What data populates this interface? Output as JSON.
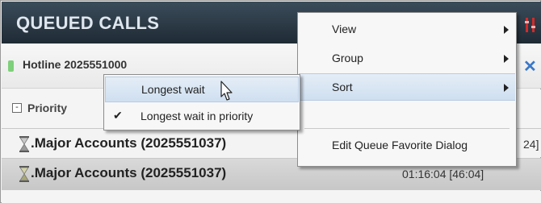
{
  "panel": {
    "title": "QUEUED CALLS",
    "hotline": "Hotline 2025551000",
    "priority_label": "Priority",
    "collapse_symbol": "-",
    "colors": {
      "titlebar": "#2b3a46",
      "status_dot": "#7ed07a",
      "close": "#3a78c8",
      "settings_accent": "#d02b2b"
    }
  },
  "calls": [
    {
      "name": ".Major Accounts (2025551037)",
      "time_tail": "24]"
    },
    {
      "name": ".Major Accounts (2025551037)",
      "time": "01:16:04 [46:04]"
    }
  ],
  "menu": {
    "items": [
      {
        "label": "View",
        "has_submenu": true
      },
      {
        "label": "Group",
        "has_submenu": true
      },
      {
        "label": "Sort",
        "has_submenu": true
      },
      {
        "label": "Edit Queue Favorite Dialog",
        "has_submenu": false
      }
    ]
  },
  "sort_submenu": {
    "items": [
      {
        "label": "Longest wait",
        "checked": false
      },
      {
        "label": "Longest wait in priority",
        "checked": true
      }
    ],
    "check_symbol": "✔"
  },
  "icons": {
    "settings": "settings-icon",
    "close": "close-icon",
    "hourglass": "hourglass-icon",
    "cursor": "mouse-cursor-icon"
  }
}
